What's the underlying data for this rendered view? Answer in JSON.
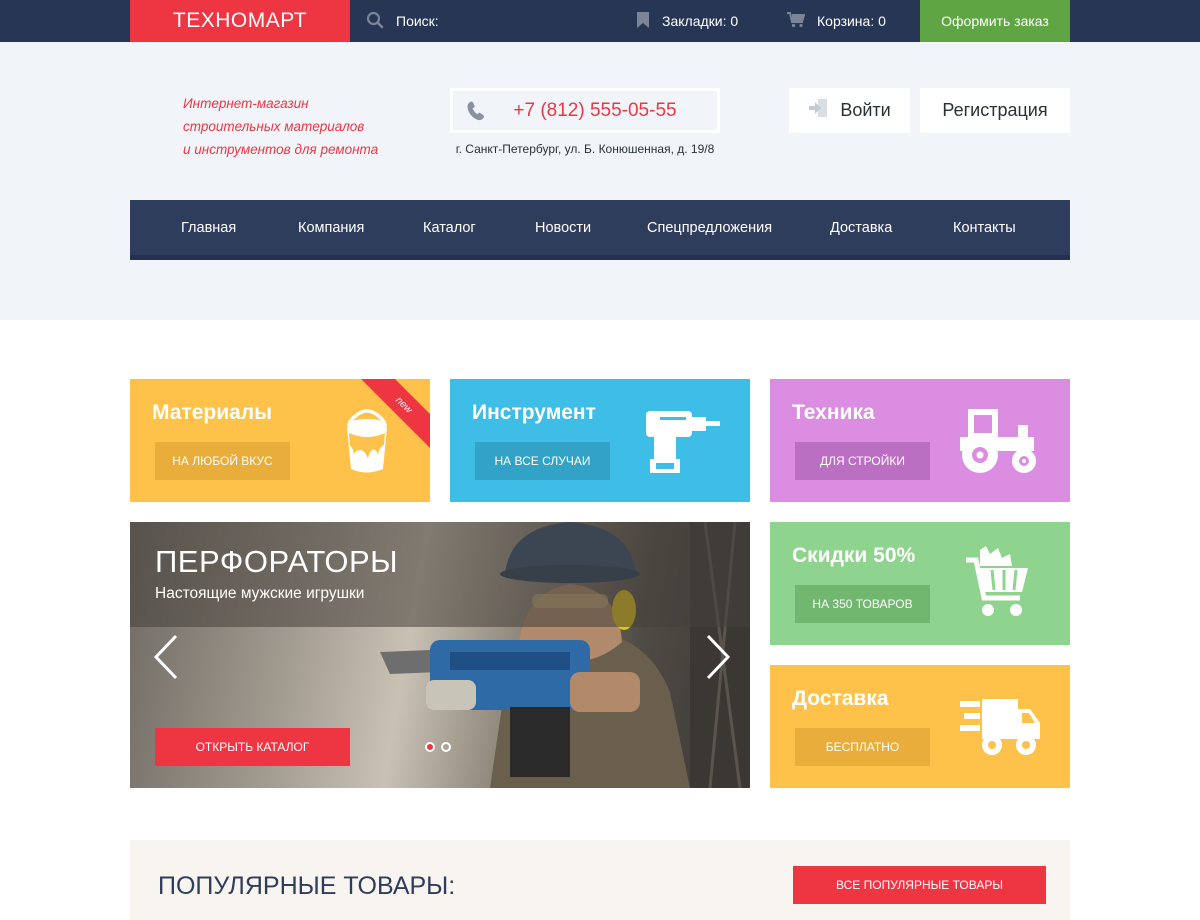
{
  "topbar": {
    "logo": "ТЕХНОМАРТ",
    "search_label": "Поиск:",
    "bookmarks_label": "Закладки: 0",
    "cart_label": "Корзина: 0",
    "order_button": "Оформить заказ"
  },
  "header": {
    "tagline": [
      "Интернет-магазин",
      "строительных материалов",
      "и инструментов для ремонта"
    ],
    "phone": "+7 (812) 555-05-55",
    "address": "г. Санкт-Петербург, ул. Б. Конюшенная, д. 19/8",
    "login": "Войти",
    "register": "Регистрация"
  },
  "nav": {
    "items": [
      "Главная",
      "Компания",
      "Каталог",
      "Новости",
      "Спецпредложения",
      "Доставка",
      "Контакты"
    ]
  },
  "tiles": [
    {
      "title": "Материалы",
      "button": "НА ЛЮБОЙ ВКУС",
      "badge": "new",
      "color": "#fec24a",
      "button_color": "#e9ad3c"
    },
    {
      "title": "Инструмент",
      "button": "НА ВСЕ СЛУЧАИ",
      "color": "#3ebde6",
      "button_color": "#32a2c7"
    },
    {
      "title": "Техника",
      "button": "ДЛЯ СТРОЙКИ",
      "color": "#db8ee1",
      "button_color": "#bb6fc3"
    },
    {
      "title": "Скидки 50%",
      "button": "НА 350 ТОВАРОВ",
      "color": "#8fd48e",
      "button_color": "#72b770"
    },
    {
      "title": "Доставка",
      "button": "БЕСПЛАТНО",
      "color": "#fec24a",
      "button_color": "#e9ad3c"
    }
  ],
  "slider": {
    "title": "ПЕРФОРАТОРЫ",
    "subtitle": "Настоящие мужские игрушки",
    "button": "ОТКРЫТЬ КАТАЛОГ",
    "slides_count": 2,
    "active_slide": 1
  },
  "popular": {
    "title": "ПОПУЛЯРНЫЕ ТОВАРЫ:",
    "button": "ВСЕ ПОПУЛЯРНЫЕ ТОВАРЫ"
  },
  "colors": {
    "accent_red": "#ee3643",
    "dark_navy": "#283655",
    "green": "#5fa543"
  }
}
